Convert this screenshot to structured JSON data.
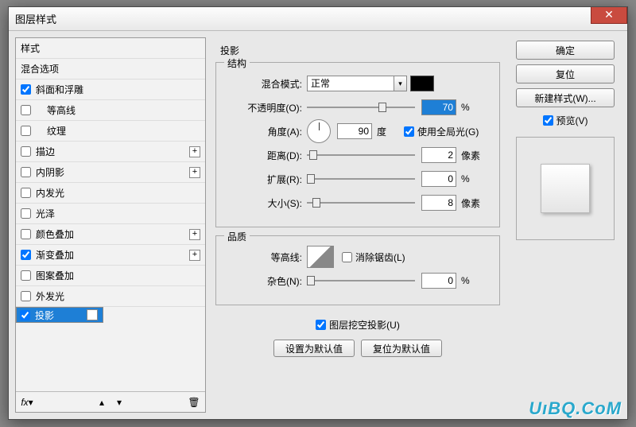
{
  "title": "图层样式",
  "watermark": "UıBQ.CoM",
  "left": {
    "header": "样式",
    "blend": "混合选项",
    "items": [
      {
        "label": "斜面和浮雕",
        "checked": true,
        "plus": false
      },
      {
        "label": "等高线",
        "checked": false,
        "plus": false,
        "indent": true
      },
      {
        "label": "纹理",
        "checked": false,
        "plus": false,
        "indent": true
      },
      {
        "label": "描边",
        "checked": false,
        "plus": true
      },
      {
        "label": "内阴影",
        "checked": false,
        "plus": true
      },
      {
        "label": "内发光",
        "checked": false,
        "plus": false
      },
      {
        "label": "光泽",
        "checked": false,
        "plus": false
      },
      {
        "label": "颜色叠加",
        "checked": false,
        "plus": true
      },
      {
        "label": "渐变叠加",
        "checked": true,
        "plus": true
      },
      {
        "label": "图案叠加",
        "checked": false,
        "plus": false
      },
      {
        "label": "外发光",
        "checked": false,
        "plus": false
      },
      {
        "label": "投影",
        "checked": true,
        "plus": true,
        "selected": true
      }
    ]
  },
  "mid": {
    "title": "投影",
    "structure": {
      "legend": "结构",
      "blendMode": {
        "label": "混合模式:",
        "value": "正常"
      },
      "opacity": {
        "label": "不透明度(O):",
        "value": "70",
        "unit": "%",
        "thumbPct": 66
      },
      "angle": {
        "label": "角度(A):",
        "value": "90",
        "unit": "度",
        "global": "使用全局光(G)",
        "globalChecked": true
      },
      "distance": {
        "label": "距离(D):",
        "value": "2",
        "unit": "像素",
        "thumbPct": 2
      },
      "spread": {
        "label": "扩展(R):",
        "value": "0",
        "unit": "%",
        "thumbPct": 0
      },
      "size": {
        "label": "大小(S):",
        "value": "8",
        "unit": "像素",
        "thumbPct": 5
      }
    },
    "quality": {
      "legend": "品质",
      "contour": {
        "label": "等高线:",
        "anti": "消除锯齿(L)",
        "antiChecked": false
      },
      "noise": {
        "label": "杂色(N):",
        "value": "0",
        "unit": "%",
        "thumbPct": 0
      }
    },
    "knockout": {
      "label": "图层挖空投影(U)",
      "checked": true
    },
    "setDefault": "设置为默认值",
    "resetDefault": "复位为默认值"
  },
  "right": {
    "ok": "确定",
    "cancel": "复位",
    "newStyle": "新建样式(W)...",
    "preview": "预览(V)"
  }
}
